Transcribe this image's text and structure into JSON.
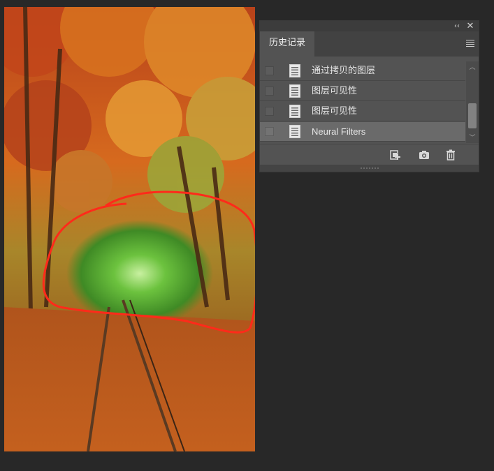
{
  "panel": {
    "tab_label": "历史记录",
    "collapse_glyph": "‹‹",
    "close_glyph": "✕",
    "menu_icon": "hamburger-menu-icon",
    "items": [
      {
        "label": "通过拷贝的图层",
        "icon": "history-state-document-icon",
        "selected": false
      },
      {
        "label": "图层可见性",
        "icon": "history-state-document-icon",
        "selected": false
      },
      {
        "label": "图层可见性",
        "icon": "history-state-document-icon",
        "selected": false
      },
      {
        "label": "Neural Filters",
        "icon": "history-state-document-icon",
        "selected": true
      }
    ],
    "footer_icons": [
      "new-document-from-state-icon",
      "camera-snapshot-icon",
      "trash-icon"
    ],
    "scroll_up_glyph": "︿",
    "scroll_down_glyph": "﹀"
  },
  "canvas": {
    "description_colors": {
      "autumn_orange": "#d46a1c",
      "green_tunnel": "#5aa830",
      "annotation_red": "#ff2a1a"
    }
  }
}
